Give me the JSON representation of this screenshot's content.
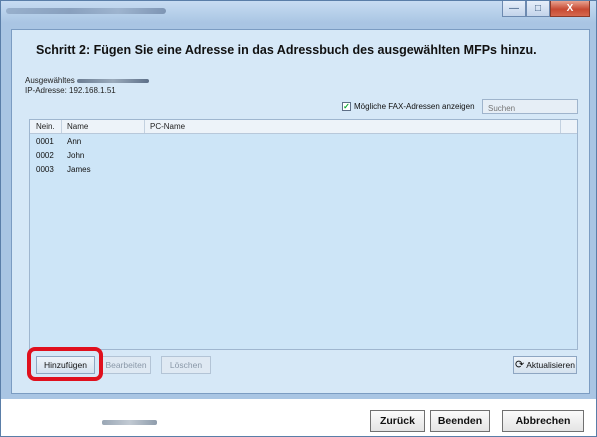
{
  "window": {
    "minimize_glyph": "—",
    "maximize_glyph": "□",
    "close_glyph": "X"
  },
  "main": {
    "heading": "Schritt 2: Fügen Sie eine Adresse in das Adressbuch des ausgewählten MFPs hinzu.",
    "selected_label": "Ausgewähltes",
    "ip_label": "IP-Adresse: 192.168.1.51",
    "show_fax_label": "Mögliche FAX-Adressen anzeigen",
    "show_fax_checked": true,
    "search_placeholder": "Suchen"
  },
  "table": {
    "columns": [
      "Nein.",
      "Name",
      "PC-Name"
    ],
    "rows": [
      {
        "no": "0001",
        "name": "Ann",
        "pc": ""
      },
      {
        "no": "0002",
        "name": "John",
        "pc": ""
      },
      {
        "no": "0003",
        "name": "James",
        "pc": ""
      }
    ]
  },
  "actions": {
    "add": "Hinzufügen",
    "edit": "Bearbeiten",
    "delete": "Löschen",
    "refresh": "Aktualisieren",
    "refresh_icon": "refresh-icon"
  },
  "footer": {
    "back": "Zurück",
    "finish": "Beenden",
    "cancel": "Abbrechen"
  },
  "colors": {
    "highlight": "#e0101d",
    "panel": "#d6e8f7",
    "list": "#cde5f7"
  }
}
